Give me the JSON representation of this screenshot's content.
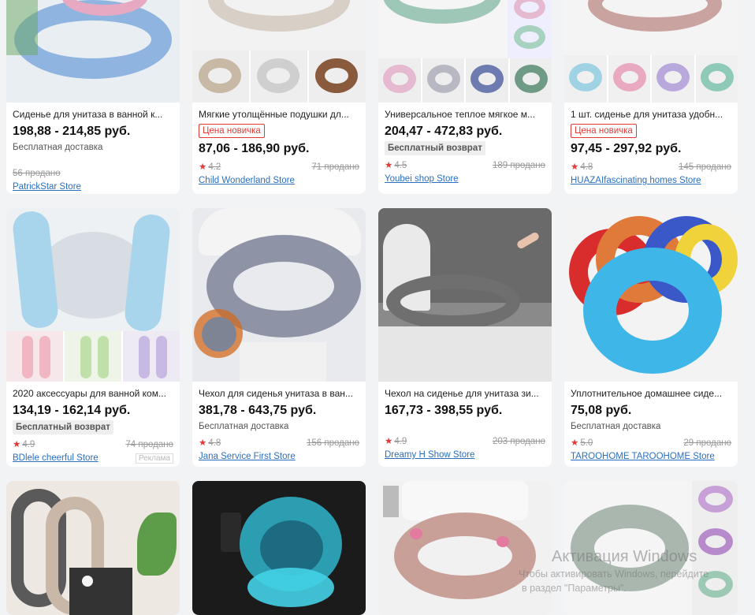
{
  "products": [
    {
      "title": "Сиденье для унитаза в ванной к...",
      "price": "198,88 - 214,85 руб.",
      "shipping": "Бесплатная доставка",
      "rating": "",
      "sold": "56 продано",
      "store": "PatrickStar Store",
      "color": "#8fb4e0"
    },
    {
      "title": "Мягкие утолщённые подушки дл...",
      "badge": "Цена новичка",
      "price": "87,06 - 186,90 руб.",
      "rating": "4.2",
      "sold": "71 продано",
      "store": "Child Wonderland Store",
      "color": "#d8cfc6"
    },
    {
      "title": "Универсальное теплое мягкое м...",
      "price": "204,47 - 472,83 руб.",
      "badge_return": "Бесплатный возврат",
      "rating": "4.5",
      "sold": "189 продано",
      "store": "Youbei shop Store",
      "color": "#9fc7b8"
    },
    {
      "title": "1 шт. сиденье для унитаза удобн...",
      "badge": "Цена новичка",
      "price": "97,45 - 297,92 руб.",
      "rating": "4.8",
      "sold": "145 продано",
      "store": "HUAZAIfascinating homes Store",
      "color": "#c9a3a0"
    },
    {
      "title": "2020 аксессуары для ванной ком...",
      "price": "134,19 - 162,14 руб.",
      "badge_return": "Бесплатный возврат",
      "rating": "4.9",
      "sold": "74 продано",
      "store": "BDlele cheerful Store",
      "ad": "Реклама",
      "color": "#a8d4ec"
    },
    {
      "title": "Чехол для сиденья унитаза в ван...",
      "price": "381,78 - 643,75 руб.",
      "shipping": "Бесплатная доставка",
      "rating": "4.8",
      "sold": "156 продано",
      "store": "Jana Service First Store",
      "color": "#8e93a6"
    },
    {
      "title": "Чехол на сиденье для унитаза зи...",
      "price": "167,73 - 398,55 руб.",
      "rating": "4.9",
      "sold": "203 продано",
      "store": "Dreamy H Show Store",
      "color": "#6f6f6f"
    },
    {
      "title": "Уплотнительное домашнее сиде...",
      "price": "75,08 руб.",
      "shipping": "Бесплатная доставка",
      "rating": "5.0",
      "sold": "29 продано",
      "store": "TAROOHOME TAROOHOME Store",
      "color": "#3fb6e8"
    },
    {
      "color": "#c9b7a8"
    },
    {
      "color": "#1b1b1b"
    },
    {
      "color": "#c8a098"
    },
    {
      "color": "#a9b7ae"
    }
  ],
  "watermark": {
    "line1": "Активация Windows",
    "line2": "Чтобы активировать Windows, перейдите",
    "line3": "в раздел \"Параметры\"."
  }
}
